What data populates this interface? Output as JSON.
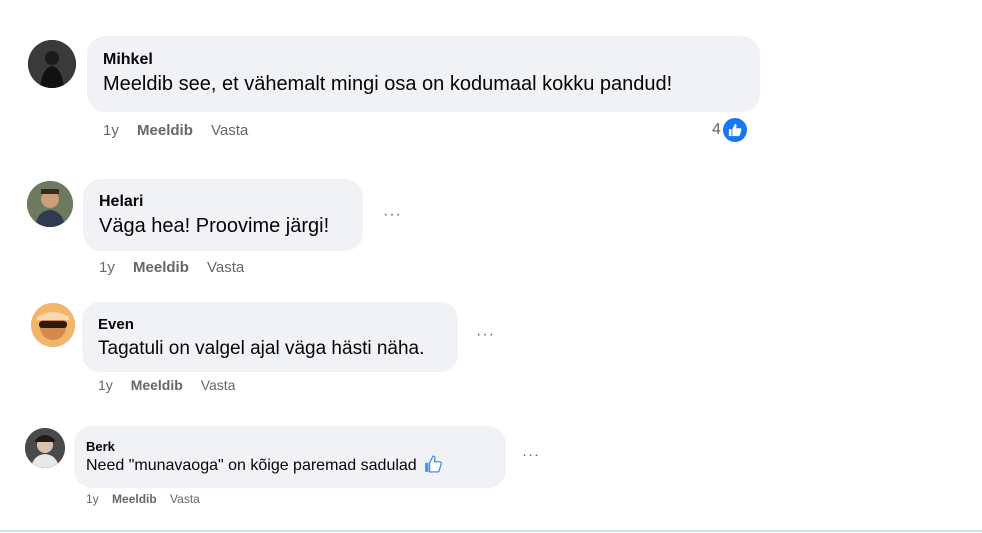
{
  "comments": [
    {
      "author": "Mihkel",
      "text": "Meeldib see, et vähemalt mingi osa on kodumaal kokku pandud!",
      "time": "1y",
      "like_label": "Meeldib",
      "reply_label": "Vasta",
      "reaction_count": "4",
      "reaction_icon": "like-icon"
    },
    {
      "author": "Helari",
      "text": "Väga hea! Proovime järgi!",
      "time": "1y",
      "like_label": "Meeldib",
      "reply_label": "Vasta",
      "more_label": "···"
    },
    {
      "author": "Even",
      "text": "Tagatuli on valgel ajal väga hästi näha.",
      "time": "1y",
      "like_label": "Meeldib",
      "reply_label": "Vasta",
      "more_label": "···"
    },
    {
      "author": "Berk",
      "text": "Need \"munavaoga\" on kõige paremad sadulad",
      "time": "1y",
      "like_label": "Meeldib",
      "reply_label": "Vasta",
      "more_label": "···",
      "emoji_icon": "thumbs-up-emoji-icon"
    }
  ],
  "colors": {
    "bubble": "#f0f2f5",
    "meta_text": "#65676b",
    "like_blue": "#1877f2"
  }
}
